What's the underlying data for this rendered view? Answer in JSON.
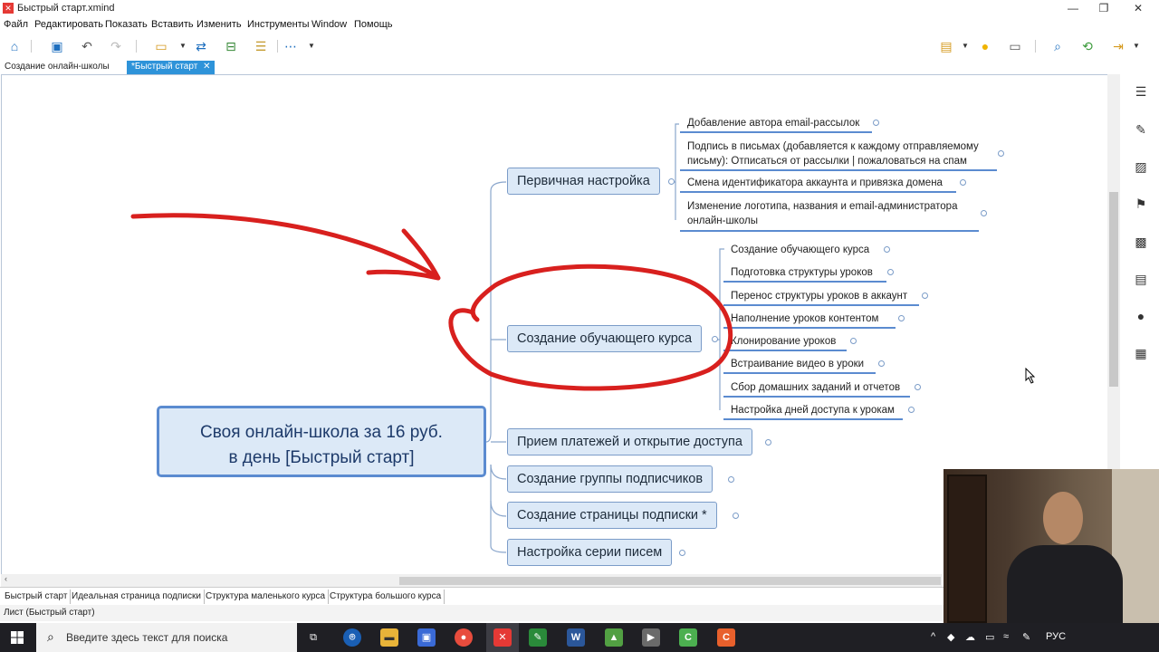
{
  "window": {
    "title": "Быстрый старт.xmind",
    "app_icon": "xmind-icon"
  },
  "menu": [
    "Файл",
    "Редактировать",
    "Показать",
    "Вставить",
    "Изменить",
    "Инструменты",
    "Window",
    "Помощь"
  ],
  "editor_tabs": [
    {
      "label": "Создание онлайн-школы",
      "active": false
    },
    {
      "label": "*Быстрый старт",
      "active": true,
      "close": "✕"
    }
  ],
  "mindmap": {
    "central": {
      "line1": "Своя онлайн-школа за 16 руб.",
      "line2": "в день [Быстрый старт]"
    },
    "topics": [
      {
        "label": "Первичная настройка",
        "subtopics": [
          [
            "Добавление автора email-рассылок"
          ],
          [
            "Подпись в письмах (добавляется к каждому отправляемому",
            "письму): Отписаться от рассылки | пожаловаться на спам"
          ],
          [
            "Смена идентификатора аккаунта и привязка домена"
          ],
          [
            "Изменение логотипа, названия и email-администратора",
            "онлайн-школы"
          ]
        ]
      },
      {
        "label": "Создание обучающего курса",
        "subtopics": [
          [
            "Создание обучающего курса"
          ],
          [
            "Подготовка структуры уроков"
          ],
          [
            "Перенос структуры уроков в аккаунт"
          ],
          [
            "Наполнение уроков контентом"
          ],
          [
            "Клонирование уроков"
          ],
          [
            "Встраивание видео в уроки"
          ],
          [
            "Сбор домашних заданий и отчетов"
          ],
          [
            "Настройка дней доступа к урокам"
          ]
        ]
      },
      {
        "label": "Прием платежей и открытие доступа"
      },
      {
        "label": "Создание группы подписчиков"
      },
      {
        "label": "Создание страницы подписки *"
      },
      {
        "label": "Настройка серии писем"
      }
    ]
  },
  "sheet_tabs": [
    {
      "label": "Быстрый старт",
      "active": true
    },
    {
      "label": "Идеальная страница подписки",
      "active": false
    },
    {
      "label": "Структура маленького курса",
      "active": false
    },
    {
      "label": "Структура большого курса",
      "active": false
    }
  ],
  "status_text": "Лист (Быстрый старт)",
  "taskbar": {
    "search_placeholder": "Введите здесь текст для поиска",
    "language": "РУС"
  },
  "colors": {
    "accent": "#2e93d9",
    "topic_fill": "#dce9f7",
    "topic_border": "#7b9cc8",
    "annotation_red": "#d8201e"
  }
}
